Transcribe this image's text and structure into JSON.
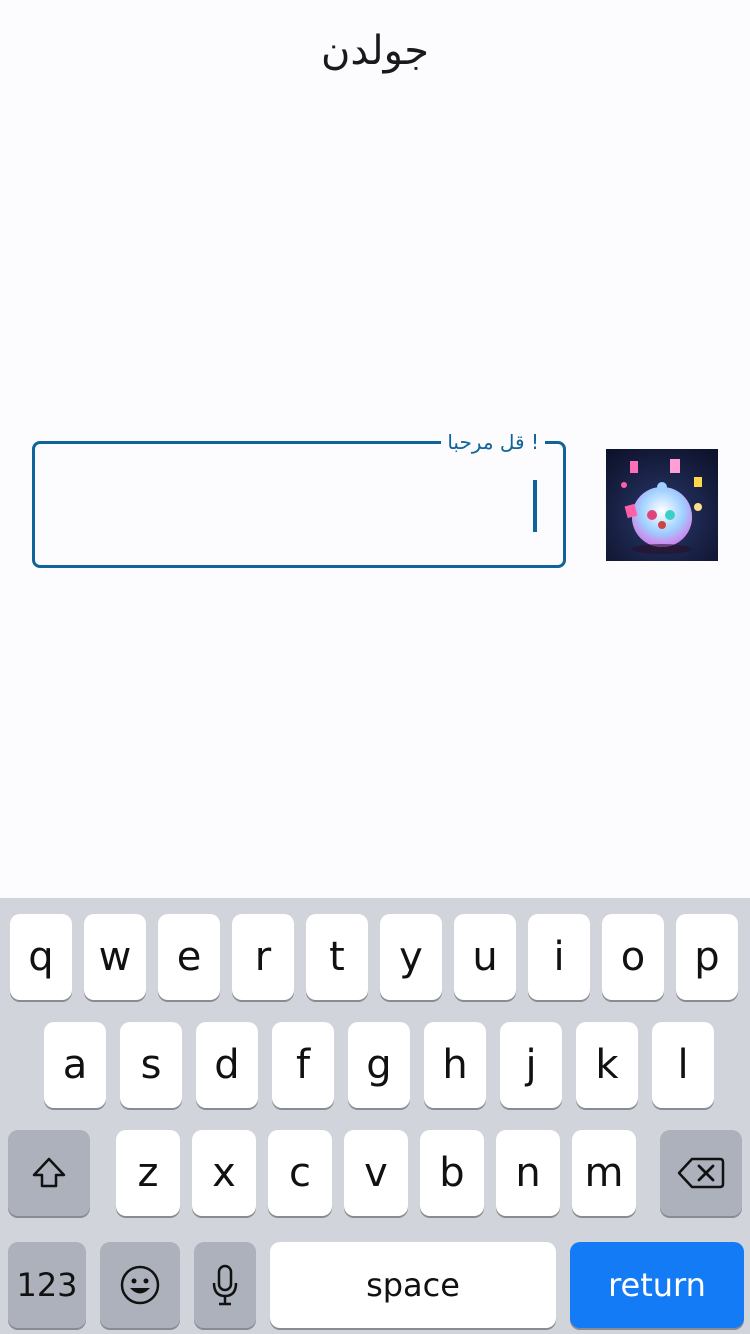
{
  "header": {
    "title": "جولدن"
  },
  "message_input": {
    "label": "! قل مرحبا",
    "value": ""
  },
  "avatar": {
    "icon": "avatar-image"
  },
  "keyboard": {
    "row1": [
      "q",
      "w",
      "e",
      "r",
      "t",
      "y",
      "u",
      "i",
      "o",
      "p"
    ],
    "row2": [
      "a",
      "s",
      "d",
      "f",
      "g",
      "h",
      "j",
      "k",
      "l"
    ],
    "row3": [
      "z",
      "x",
      "c",
      "v",
      "b",
      "n",
      "m"
    ],
    "numbers_label": "123",
    "space_label": "space",
    "return_label": "return",
    "icons": {
      "shift": "shift-icon",
      "backspace": "backspace-icon",
      "emoji": "emoji-icon",
      "mic": "microphone-icon"
    }
  },
  "colors": {
    "accent": "#10649a",
    "return_key": "#147bf6",
    "keyboard_bg": "#d1d4db"
  }
}
